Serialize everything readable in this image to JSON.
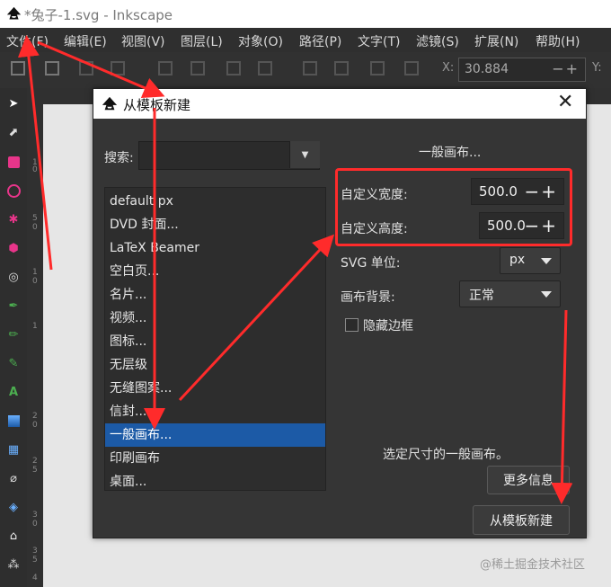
{
  "window": {
    "title": "*兔子-1.svg - Inkscape"
  },
  "menubar": {
    "items": [
      "文件(F)",
      "编辑(E)",
      "视图(V)",
      "图层(L)",
      "对象(O)",
      "路径(P)",
      "文字(T)",
      "滤镜(S)",
      "扩展(N)",
      "帮助(H)"
    ]
  },
  "commandbar": {
    "x_label": "X:",
    "x_value": "30.884",
    "x_controls": "−+",
    "y_label": "Y:"
  },
  "ruler": {
    "ticks": [
      "1",
      "0",
      "5",
      "0",
      "1",
      "0",
      "1",
      "2",
      "0",
      "2",
      "5",
      "3",
      "0",
      "3",
      "5",
      "4"
    ]
  },
  "dialog": {
    "title": "从模板新建",
    "search_label": "搜索:",
    "search_value": "",
    "templates": [
      "default px",
      "DVD 封面...",
      "LaTeX Beamer",
      "空白页...",
      "名片...",
      "视频...",
      "图标...",
      "无层级",
      "无缝图案...",
      "信封...",
      "一般画布...",
      "印刷画布",
      "桌面..."
    ],
    "selected_index": 10,
    "template_heading": "一般画布...",
    "width_label": "自定义宽度:",
    "width_value": "500.0",
    "height_label": "自定义高度:",
    "height_value": "500.0",
    "spin_controls": "−+",
    "unit_label": "SVG 单位:",
    "unit_value": "px",
    "background_label": "画布背景:",
    "background_value": "正常",
    "hide_border_label": "隐藏边框",
    "hide_border_checked": false,
    "description": "选定尺寸的一般画布。",
    "more_info_button": "更多信息",
    "create_button": "从模板新建"
  },
  "watermark": "@稀土掘金技术社区",
  "colors": {
    "accent": "#1c5aa6",
    "annotation": "#ff2b2b",
    "dialog_bg": "#353535"
  }
}
